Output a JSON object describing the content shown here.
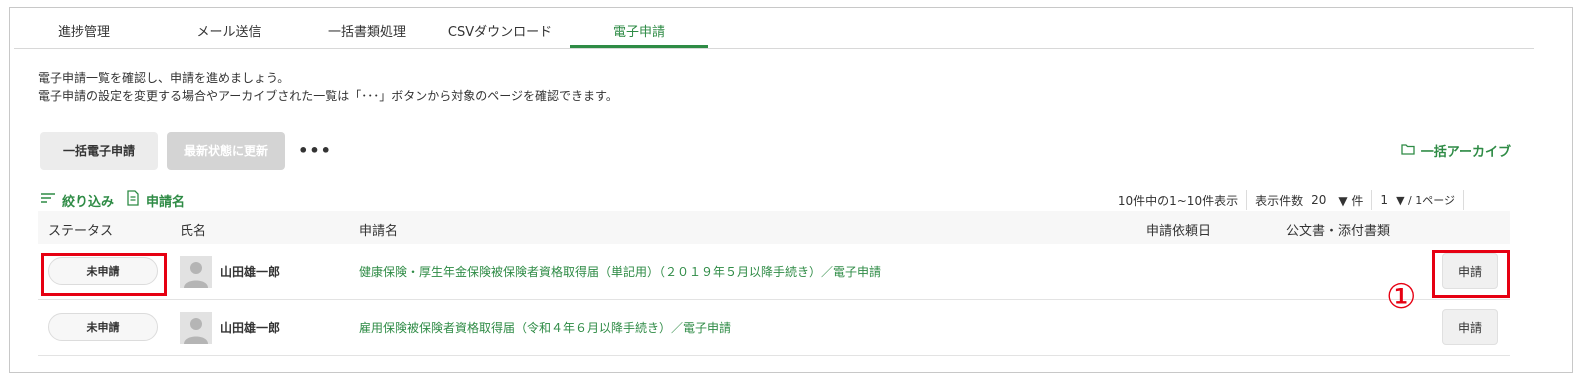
{
  "tabs": [
    {
      "label": "進捗管理",
      "active": false
    },
    {
      "label": "メール送信",
      "active": false
    },
    {
      "label": "一括書類処理",
      "active": false
    },
    {
      "label": "CSVダウンロード",
      "active": false
    },
    {
      "label": "電子申請",
      "active": true
    }
  ],
  "description": {
    "line1": "電子申請一覧を確認し、申請を進めましょう。",
    "line2": "電子申請の設定を変更する場合やアーカイブされた一覧は「･･･」ボタンから対象のページを確認できます。"
  },
  "toolbar": {
    "bulk_apply_label": "一括電子申請",
    "refresh_label": "最新状態に更新",
    "more_label": "•••",
    "archive_label": "一括アーカイブ"
  },
  "filter": {
    "filter_label": "絞り込み",
    "app_name_label": "申請名"
  },
  "pager": {
    "summary": "10件中の1~10件表示",
    "per_page_label": "表示件数",
    "per_page_value": "20",
    "per_page_unit": "▼ 件",
    "page_value": "1",
    "page_suffix": "▼ / 1ページ"
  },
  "table": {
    "headers": {
      "status": "ステータス",
      "name": "氏名",
      "application": "申請名",
      "request_date": "申請依頼日",
      "documents": "公文書・添付書類"
    },
    "rows": [
      {
        "status": "未申請",
        "name": "山田雄一郎",
        "application": "健康保険・厚生年金保険被保険者資格取得届（単記用）（２０１９年５月以降手続き）／電子申請",
        "request_date": "",
        "action": "申請"
      },
      {
        "status": "未申請",
        "name": "山田雄一郎",
        "application": "雇用保険被保険者資格取得届（令和４年６月以降手続き）／電子申請",
        "request_date": "",
        "action": "申請"
      }
    ]
  },
  "annotation": {
    "marker": "①"
  },
  "colors": {
    "accent": "#2e8b45",
    "highlight": "#e60012"
  }
}
